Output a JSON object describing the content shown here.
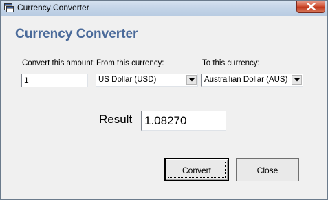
{
  "window": {
    "title": "Currency Converter"
  },
  "form": {
    "heading": "Currency Converter",
    "amount_label": "Convert this amount:",
    "amount_value": "1",
    "from_label": "From this currency:",
    "from_selected": "US Dollar (USD)",
    "to_label": "To this currency:",
    "to_selected": "Australlian Dollar (AUS)",
    "result_label": "Result",
    "result_value": "1.08270",
    "convert_label": "Convert",
    "close_label": "Close"
  }
}
